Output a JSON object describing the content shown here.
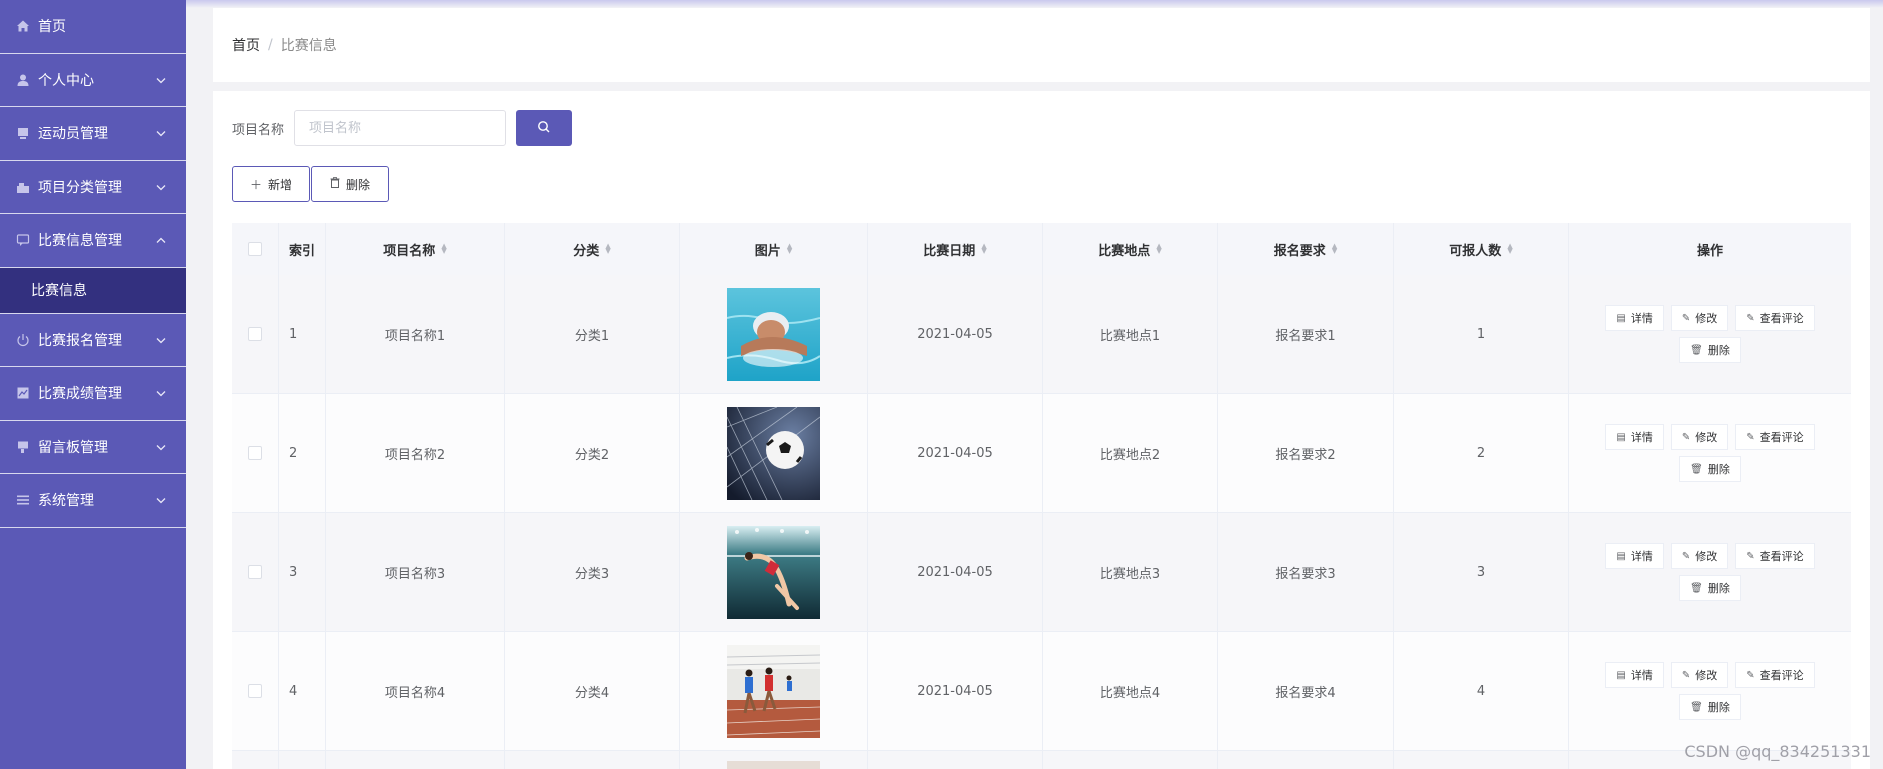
{
  "sidebar": {
    "items": [
      {
        "label": "首页",
        "icon": "home-icon",
        "expandable": false
      },
      {
        "label": "个人中心",
        "icon": "user-icon",
        "expandable": true
      },
      {
        "label": "运动员管理",
        "icon": "doc-icon",
        "expandable": true
      },
      {
        "label": "项目分类管理",
        "icon": "category-icon",
        "expandable": true
      },
      {
        "label": "比赛信息管理",
        "icon": "chat-icon",
        "expandable": true,
        "expanded": true
      },
      {
        "label": "比赛报名管理",
        "icon": "power-icon",
        "expandable": true
      },
      {
        "label": "比赛成绩管理",
        "icon": "chart-icon",
        "expandable": true
      },
      {
        "label": "留言板管理",
        "icon": "message-icon",
        "expandable": true
      },
      {
        "label": "系统管理",
        "icon": "list-icon",
        "expandable": true
      }
    ],
    "submenu_active": "比赛信息"
  },
  "breadcrumb": {
    "home": "首页",
    "separator": "/",
    "current": "比赛信息"
  },
  "search": {
    "label": "项目名称",
    "placeholder": "项目名称",
    "value": ""
  },
  "actions": {
    "add": "新增",
    "delete": "删除"
  },
  "table": {
    "headers": [
      "索引",
      "项目名称",
      "分类",
      "图片",
      "比赛日期",
      "比赛地点",
      "报名要求",
      "可报人数",
      "操作"
    ],
    "rows": [
      {
        "index": "1",
        "name": "项目名称1",
        "category": "分类1",
        "image": "swimming",
        "date": "2021-04-05",
        "place": "比赛地点1",
        "requirement": "报名要求1",
        "count": "1"
      },
      {
        "index": "2",
        "name": "项目名称2",
        "category": "分类2",
        "image": "soccer",
        "date": "2021-04-05",
        "place": "比赛地点2",
        "requirement": "报名要求2",
        "count": "2"
      },
      {
        "index": "3",
        "name": "项目名称3",
        "category": "分类3",
        "image": "high-jump",
        "date": "2021-04-05",
        "place": "比赛地点3",
        "requirement": "报名要求3",
        "count": "3"
      },
      {
        "index": "4",
        "name": "项目名称4",
        "category": "分类4",
        "image": "running",
        "date": "2021-04-05",
        "place": "比赛地点4",
        "requirement": "报名要求4",
        "count": "4"
      }
    ],
    "row_actions": {
      "detail": "详情",
      "edit": "修改",
      "comments": "查看评论",
      "delete": "删除"
    }
  },
  "watermark": "CSDN @qq_834251331",
  "colors": {
    "primary": "#5b59b6",
    "submenu_active_bg": "#33307f"
  }
}
